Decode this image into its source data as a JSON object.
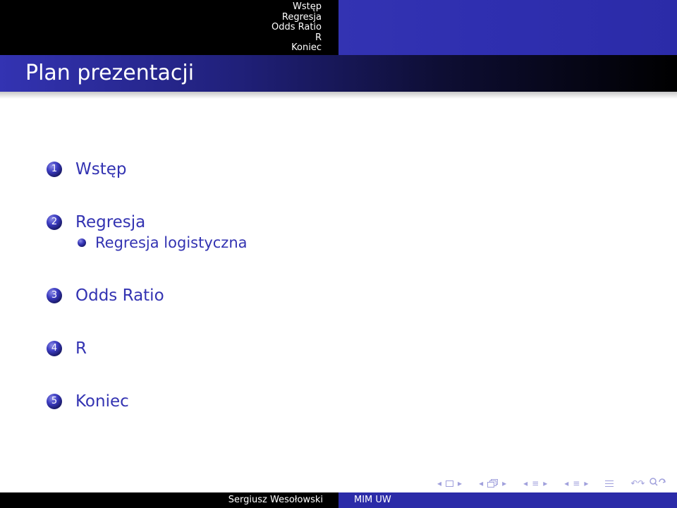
{
  "header": {
    "sections": [
      "Wstęp",
      "Regresja",
      "Odds Ratio",
      "R",
      "Koniec"
    ]
  },
  "frame": {
    "title": "Plan prezentacji"
  },
  "toc": {
    "sections": [
      {
        "number": "1",
        "label": "Wstęp"
      },
      {
        "number": "2",
        "label": "Regresja",
        "subsections": [
          "Regresja logistyczna"
        ]
      },
      {
        "number": "3",
        "label": "Odds Ratio"
      },
      {
        "number": "4",
        "label": "R"
      },
      {
        "number": "5",
        "label": "Koniec"
      }
    ]
  },
  "navigation": {
    "left_arrow": "◂",
    "right_arrow": "▸",
    "equiv": "≡",
    "search_icon": "search-icon",
    "search_glyph": "↶↷"
  },
  "footer": {
    "author": "Sergiusz Wesołowski",
    "institute": "MIM UW"
  },
  "colors": {
    "structure": "#3333b2",
    "dark": "#000000",
    "nav_symbols": "#a0a0dc",
    "text_white": "#ffffff"
  }
}
